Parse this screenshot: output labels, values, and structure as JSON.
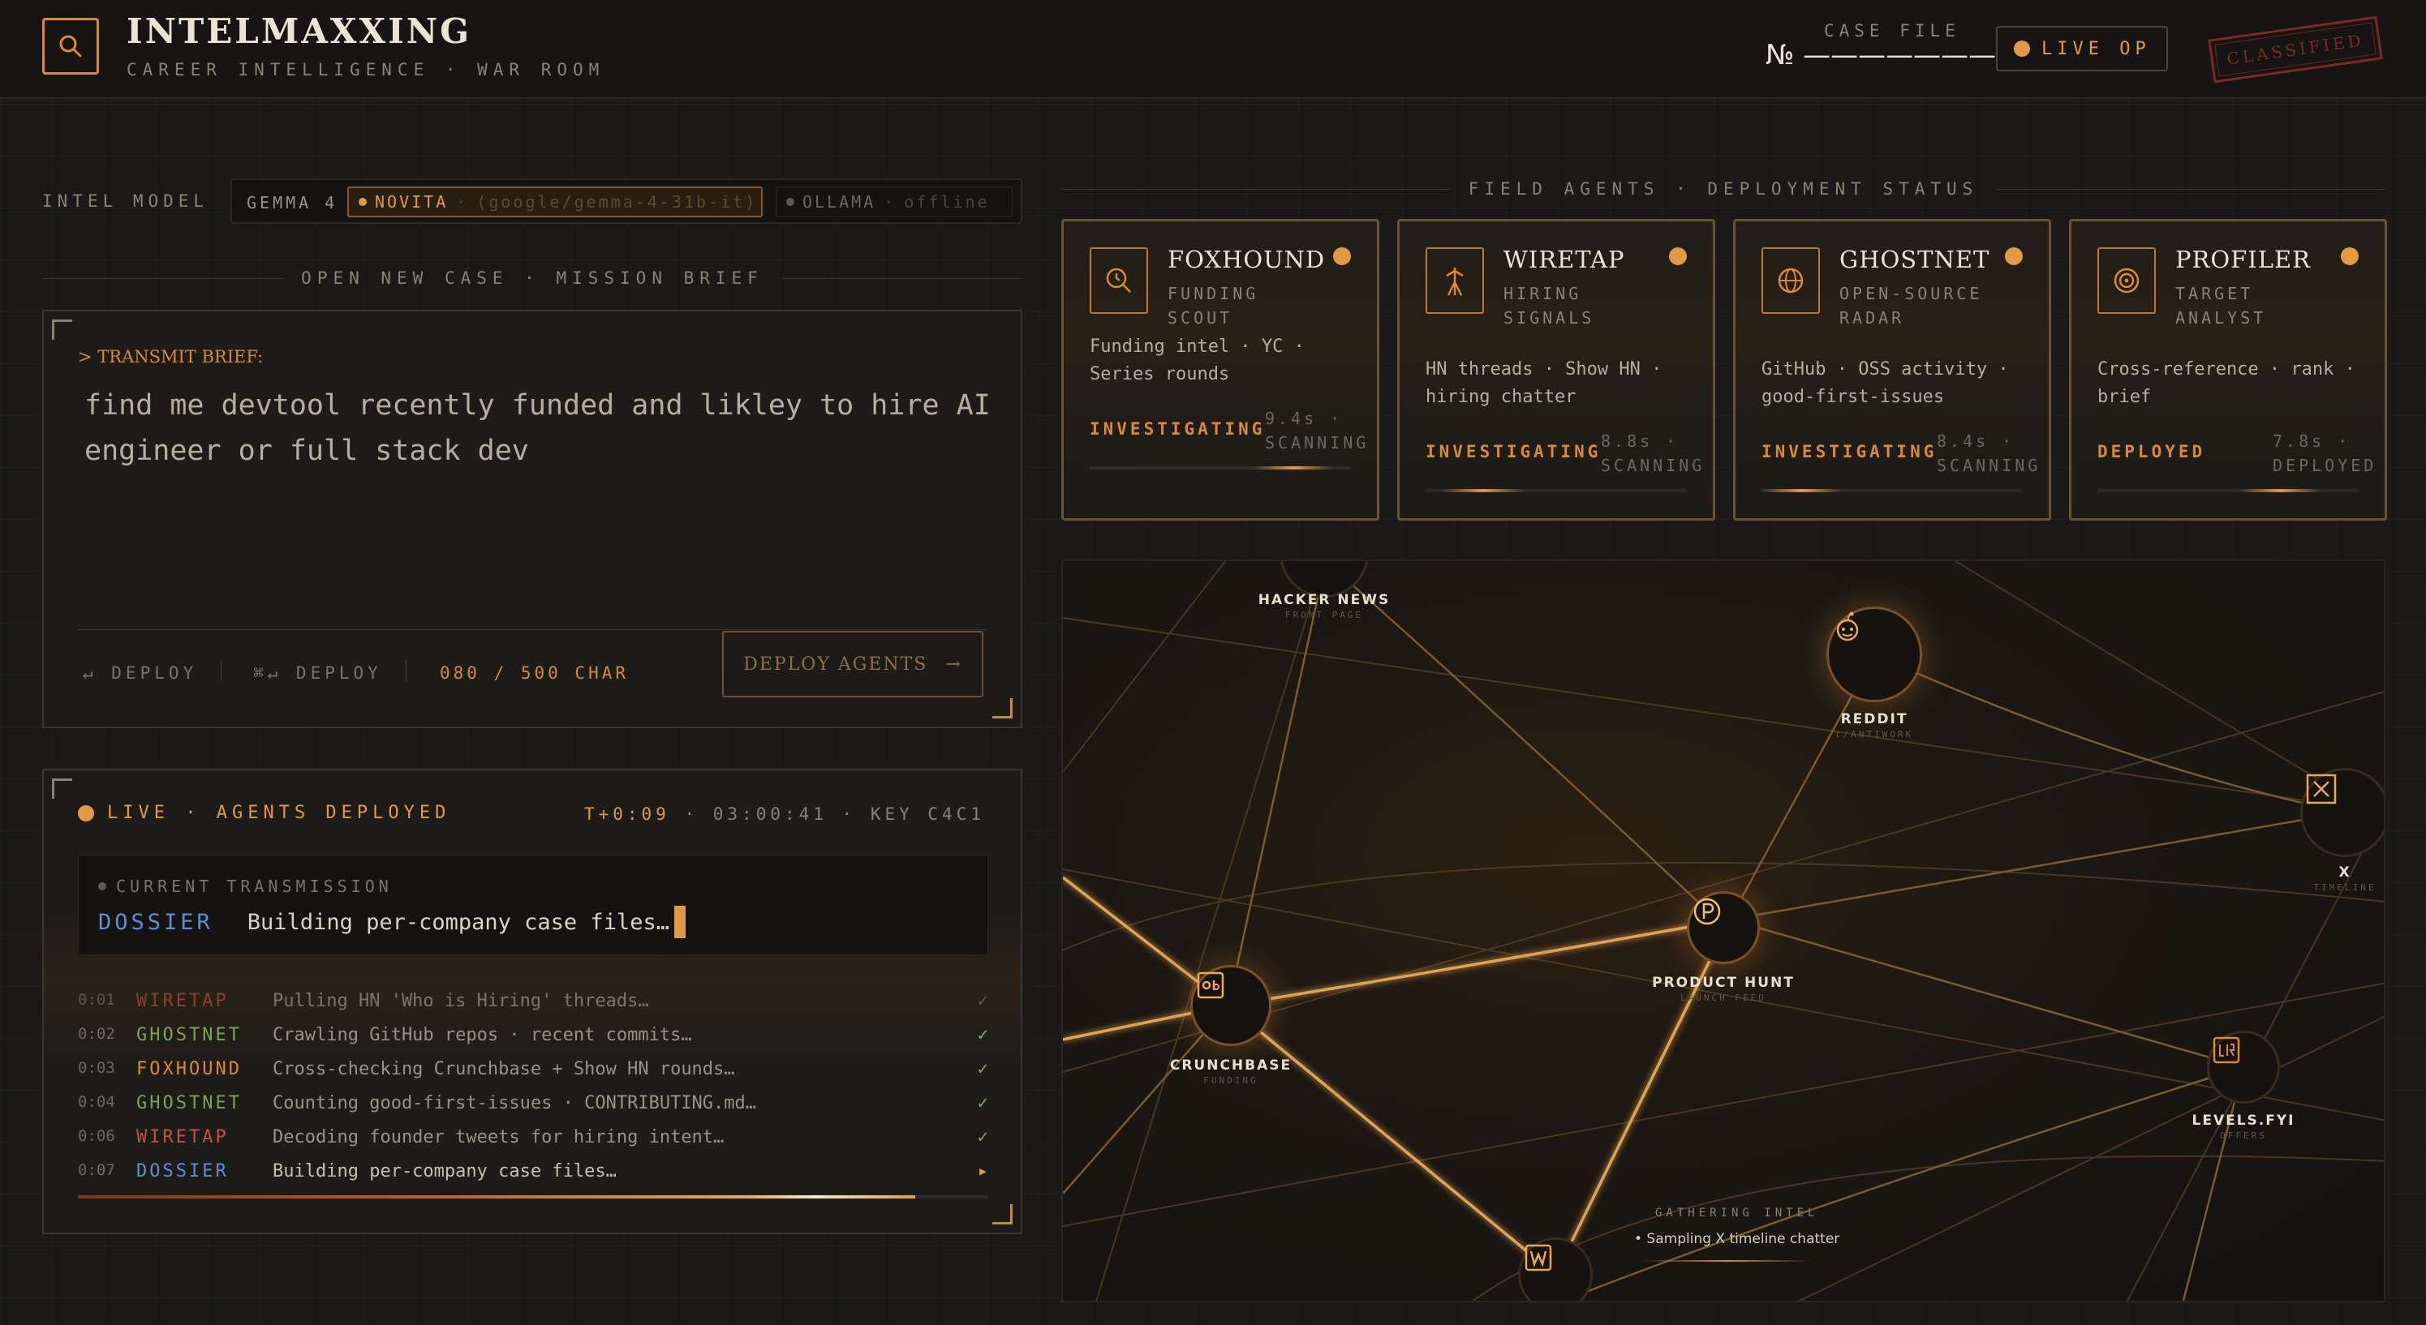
{
  "header": {
    "brand_title": "INTELMAXXING",
    "brand_subtitle": "CAREER INTELLIGENCE · WAR ROOM",
    "case_file_label": "CASE FILE",
    "case_no": "№ ———————",
    "live_op": "LIVE OP",
    "classified_stamp": "CLASSIFIED",
    "accent_color": "#e39a45"
  },
  "model": {
    "label": "INTEL MODEL",
    "name": "GEMMA 4",
    "novita_provider": "NOVITA",
    "novita_sep": "·",
    "novita_model": "(google/gemma-4-31b-it)",
    "ollama_provider": "OLLAMA",
    "ollama_sep": "·",
    "ollama_status": "offline"
  },
  "brief": {
    "section_title": "OPEN NEW CASE · MISSION BRIEF",
    "label": "> TRANSMIT BRIEF:",
    "text": "find me devtool recently funded and likley to hire AI engineer or full stack dev",
    "hint_enter": "↵ DEPLOY",
    "hint_cmd": "⌘↵ DEPLOY",
    "char_count": "080 / 500 CHAR",
    "deploy_button": "DEPLOY AGENTS",
    "deploy_arrow": "→"
  },
  "live": {
    "status": "LIVE · AGENTS DEPLOYED",
    "elapsed": "T+0:09",
    "meta": "· 03:00:41 · KEY C4C1",
    "transmission_label": "CURRENT TRANSMISSION",
    "transmission_agent": "DOSSIER",
    "transmission_text": "Building per-company case files…",
    "progress": 0.92,
    "log": [
      {
        "time": "0:01",
        "agent": "WIRETAP",
        "agent_color": "#a84a3c",
        "text": "Pulling HN 'Who is Hiring' threads…",
        "status": "✓",
        "status_color": "#5f7d45"
      },
      {
        "time": "0:02",
        "agent": "GHOSTNET",
        "agent_color": "#7ea253",
        "text": "Crawling GitHub repos · recent commits…",
        "status": "✓",
        "status_color": "#7fae54"
      },
      {
        "time": "0:03",
        "agent": "FOXHOUND",
        "agent_color": "#d98a36",
        "text": "Cross-checking Crunchbase + Show HN rounds…",
        "status": "✓",
        "status_color": "#7fae54"
      },
      {
        "time": "0:04",
        "agent": "GHOSTNET",
        "agent_color": "#7ea253",
        "text": "Counting good-first-issues · CONTRIBUTING.md…",
        "status": "✓",
        "status_color": "#7fae54"
      },
      {
        "time": "0:06",
        "agent": "WIRETAP",
        "agent_color": "#c2533f",
        "text": "Decoding founder tweets for hiring intent…",
        "status": "✓",
        "status_color": "#7fae54"
      },
      {
        "time": "0:07",
        "agent": "DOSSIER",
        "agent_color": "#5b8fd6",
        "text": "Building per-company case files…",
        "status": "▸",
        "status_color": "#e39a45"
      }
    ]
  },
  "agents": {
    "section_title": "FIELD AGENTS · DEPLOYMENT STATUS",
    "cards": [
      {
        "name": "FOXHOUND",
        "role": "FUNDING SCOUT",
        "icon": "clock-search-icon",
        "desc": "Funding intel · YC · Series rounds",
        "state": "INVESTIGATING",
        "meta": "9.4s · SCANNING",
        "bar_level": 0.78
      },
      {
        "name": "WIRETAP",
        "role": "HIRING SIGNALS",
        "icon": "antenna-icon",
        "desc": "HN threads · Show HN · hiring chatter",
        "state": "INVESTIGATING",
        "meta": "8.8s · SCANNING",
        "bar_level": 0.22
      },
      {
        "name": "GHOSTNET",
        "role": "OPEN-SOURCE RADAR",
        "icon": "globe-icon",
        "desc": "GitHub · OSS activity · good-first-issues",
        "state": "INVESTIGATING",
        "meta": "8.4s · SCANNING",
        "bar_level": 0.05
      },
      {
        "name": "PROFILER",
        "role": "TARGET ANALYST",
        "icon": "target-icon",
        "desc": "Cross-reference · rank · brief",
        "state": "DEPLOYED",
        "meta": "7.8s · DEPLOYED",
        "bar_level": 0.7
      }
    ]
  },
  "map": {
    "nodes": [
      {
        "label": "HACKER NEWS",
        "sub": "FRONT PAGE",
        "icon": "hacker-news-icon"
      },
      {
        "label": "REDDIT",
        "sub": "r/ANTIWORK",
        "icon": "reddit-icon"
      },
      {
        "label": "X",
        "sub": "TIMELINE",
        "icon": "x-icon"
      },
      {
        "label": "PRODUCT HUNT",
        "sub": "LAUNCH FEED",
        "icon": "product-hunt-icon"
      },
      {
        "label": "CRUNCHBASE",
        "sub": "FUNDING",
        "icon": "crunchbase-icon"
      },
      {
        "label": "LEVELS.FYI",
        "sub": "OFFERS",
        "icon": "levels-fyi-icon"
      },
      {
        "label": "",
        "sub": "",
        "icon": "wellfound-icon"
      }
    ],
    "gather_label": "GATHERING INTEL",
    "gather_text": "• Sampling X timeline chatter"
  }
}
